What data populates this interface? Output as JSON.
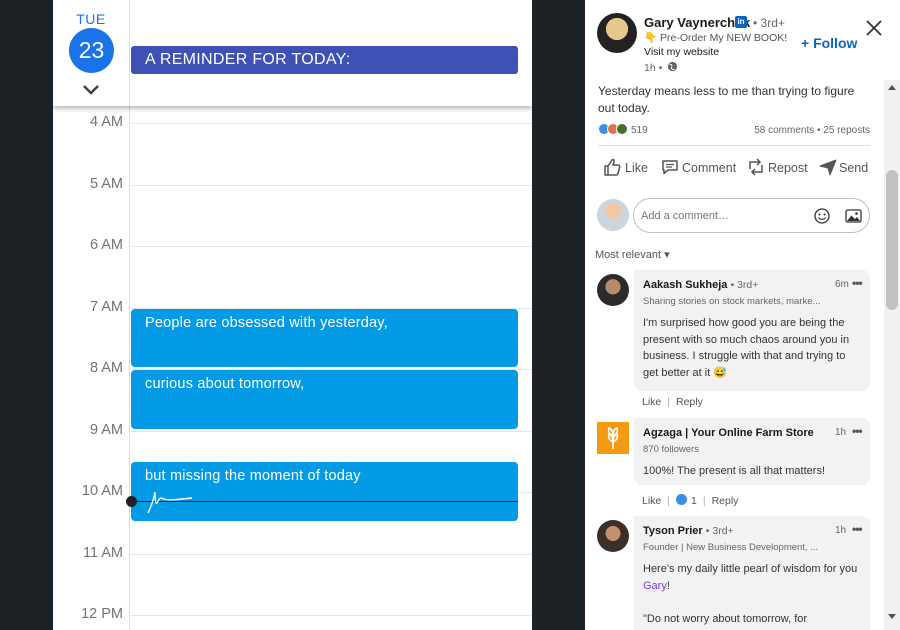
{
  "calendar": {
    "day_name": "TUE",
    "day_number": "23",
    "reminder": "A REMINDER FOR TODAY:",
    "hours": [
      "4 AM",
      "5 AM",
      "6 AM",
      "7 AM",
      "8 AM",
      "9 AM",
      "10 AM",
      "11 AM",
      "12 PM"
    ],
    "events": [
      "People are obsessed with yesterday,",
      "curious about tomorrow,",
      "but missing the moment of today"
    ],
    "colors": {
      "accent": "#1a73e8",
      "reminder_bg": "#3f51b5",
      "event_bg": "#039be5"
    }
  },
  "post": {
    "author": {
      "name": "Gary Vaynerchuk",
      "badge": "in",
      "degree": "• 3rd+",
      "tagline": "👇 Pre-Order My NEW BOOK!",
      "link": "Visit my website",
      "time": "1h •"
    },
    "follow_label": "+ Follow",
    "text": "Yesterday means less to me than trying to figure out today.",
    "reaction_count": "519",
    "comment_stats": "58 comments • 25 reposts",
    "actions": {
      "like": "Like",
      "comment": "Comment",
      "repost": "Repost",
      "send": "Send"
    },
    "comment_placeholder": "Add a comment…",
    "sort_label": "Most relevant ▾",
    "colors": {
      "brand": "#0a66c2"
    }
  },
  "comments": [
    {
      "name": "Aakash Sukheja",
      "degree": "• 3rd+",
      "subtitle": "Sharing stories on stock markets, marke...",
      "time": "6m",
      "text": "I'm surprised how good you are being the present with so much chaos around you in business. I struggle with that and trying to get better at it 😅",
      "like": "Like",
      "reply": "Reply"
    },
    {
      "name": "Agzaga | Your Online Farm Store",
      "subtitle": "870 followers",
      "time": "1h",
      "text": "100%! The present is all that matters!",
      "like": "Like",
      "like_count": "1",
      "reply": "Reply"
    },
    {
      "name": "Tyson Prier",
      "degree": "• 3rd+",
      "subtitle": "Founder | New Business Development, ...",
      "time": "1h",
      "text_before": "Here's my daily little pearl of wisdom for you ",
      "mention": "Gary",
      "text_after": "!",
      "text2": "\"Do not worry about tomorrow, for"
    }
  ]
}
